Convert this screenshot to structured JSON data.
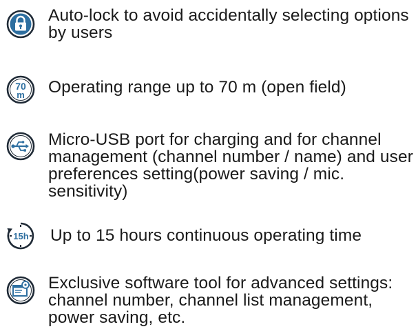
{
  "features": [
    {
      "icon": "lock-icon",
      "text": "Auto-lock to avoid accidentally selecting options by users"
    },
    {
      "icon": "range-70m-icon",
      "text": "Operating range up to 70 m (open field)",
      "badge_top": "70",
      "badge_bottom": "m"
    },
    {
      "icon": "usb-icon",
      "text": "Micro-USB port for charging and for channel management (channel number / name) and user preferences setting(power saving / mic. sensitivity)"
    },
    {
      "icon": "timer-15h-icon",
      "text": "Up to 15 hours continuous operating time",
      "badge": "15h"
    },
    {
      "icon": "software-tool-icon",
      "text": "Exclusive software tool for advanced settings: channel number, channel list management, power saving, etc."
    }
  ],
  "colors": {
    "icon_blue": "#2e6fa0",
    "icon_dark": "#1f2a36",
    "text": "#1a1a1a"
  }
}
